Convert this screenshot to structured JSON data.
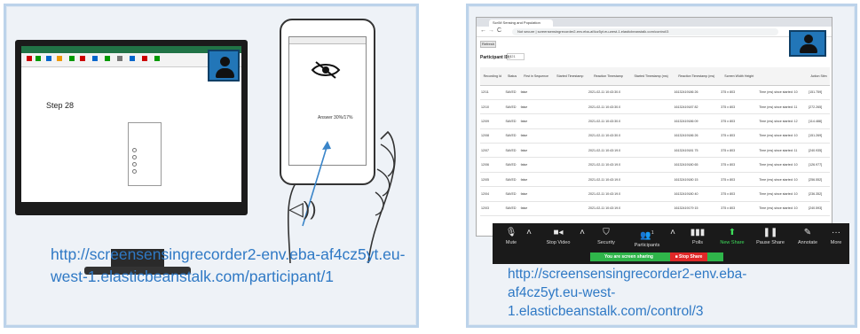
{
  "left": {
    "step_label": "Step 28",
    "phone_overlay_text": "Answer 30%/17%",
    "url": "http://screensensingrecorder2-env.eba-af4cz5yt.eu-west-1.elasticbeanstalk.com/participant/1"
  },
  "right": {
    "browser_tab": "Scr/M Sensing and Population",
    "address": "Not secure | screensensingrecorder2-env.eba-af4cz5yt.eu-west-1.elasticbeanstalk.com/control/3",
    "refresh_label": "Refresh",
    "participant_label": "Participant ID:",
    "participant_value": "321",
    "table": {
      "headers": [
        "Recording Id",
        "Status",
        "First in Sequence",
        "Started Timestamp",
        "Reaction Timestamp",
        "Started Timestamp (ms)",
        "Reaction Timestamp (ms)",
        "Screen Width Height",
        "",
        "Action Stim"
      ],
      "rows": [
        [
          "12/11",
          "SAVED",
          "false",
          "",
          "2021-02-11 10:43:30.0",
          "",
          "16132419186 26",
          "375 x 803",
          "Time (ms) since started: 10",
          "[151.759]"
        ],
        [
          "12/10",
          "SAVED",
          "false",
          "",
          "2021-02-11 10:43:30.0",
          "",
          "16132419187 82",
          "375 x 803",
          "Time (ms) since started: 11",
          "[272.265]"
        ],
        [
          "12/09",
          "SAVED",
          "false",
          "",
          "2021-02-11 10:43:30.0",
          "",
          "16132419186 09",
          "375 x 803",
          "Time (ms) since started: 12",
          "[114.488]"
        ],
        [
          "12/08",
          "SAVED",
          "false",
          "",
          "2021-02-11 10:43:30.0",
          "",
          "16132419186 26",
          "375 x 803",
          "Time (ms) since started: 10",
          "[151.269]"
        ],
        [
          "12/07",
          "SAVED",
          "false",
          "",
          "2021-02-11 10:43:19.0",
          "",
          "16132419181 75",
          "375 x 803",
          "Time (ms) since started: 11",
          "[240.935]"
        ],
        [
          "12/06",
          "SAVED",
          "false",
          "",
          "2021-02-11 10:43:19.0",
          "",
          "16132419180 65",
          "375 x 803",
          "Time (ms) since started: 10",
          "[126.977]"
        ],
        [
          "12/05",
          "SAVED",
          "false",
          "",
          "2021-02-11 10:43:19.0",
          "",
          "16132419180 15",
          "375 x 803",
          "Time (ms) since started: 10",
          "[256.552]"
        ],
        [
          "12/04",
          "SAVED",
          "false",
          "",
          "2021-02-11 10:43:19.0",
          "",
          "16132419180 40",
          "375 x 803",
          "Time (ms) since started: 10",
          "[236.352]"
        ],
        [
          "12/03",
          "SAVED",
          "false",
          "",
          "2021-02-11 10:43:19.0",
          "",
          "16132419179 15",
          "375 x 803",
          "Time (ms) since started: 10",
          "[240.593]"
        ]
      ]
    },
    "zoom": {
      "mute": "Mute",
      "stop_video": "Stop Video",
      "security": "Security",
      "participants": "Participants",
      "participants_count": "1",
      "polls": "Polls",
      "new_share": "New Share",
      "pause_share": "Pause Share",
      "annotate": "Annotate",
      "more": "More",
      "sharing_status": "You are screen sharing",
      "stop_share": "Stop Share"
    },
    "url": "http://screensensingrecorder2-env.eba-af4cz5yt.eu-west-1.elasticbeanstalk.com/control/3"
  },
  "colors": {
    "link": "#2f79c5",
    "panel_border": "#bcd3ea",
    "avatar": "#2276b8",
    "zoom_green": "#2fb54a",
    "zoom_red": "#e02828"
  }
}
